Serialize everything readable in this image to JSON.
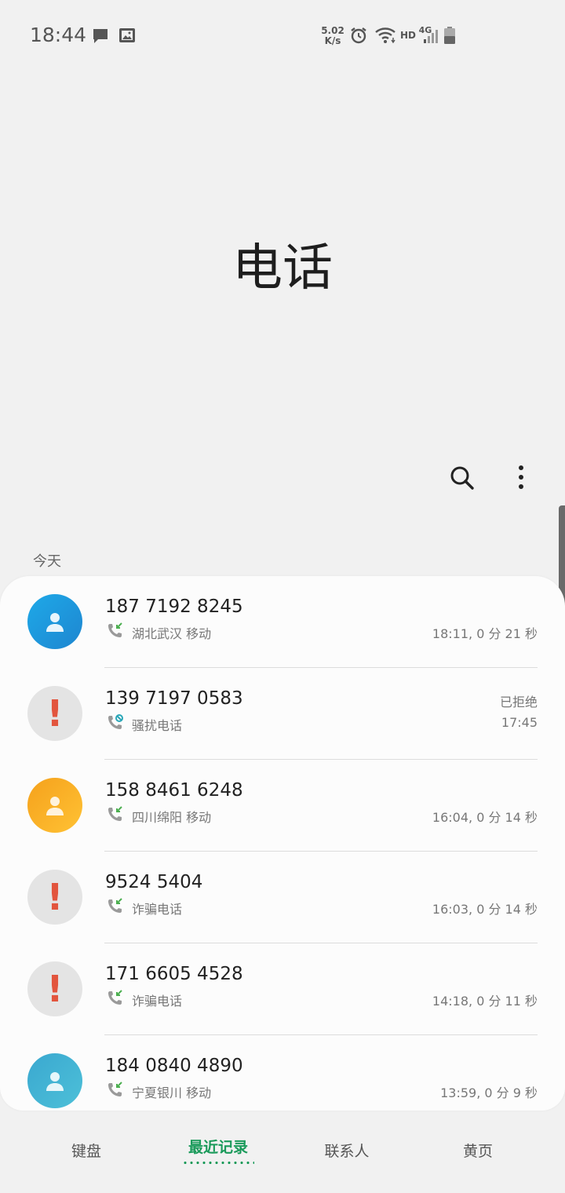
{
  "status_bar": {
    "time": "18:44",
    "net_speed_value": "5.02",
    "net_speed_unit": "K/s",
    "hd_label": "HD",
    "network_label": "4G",
    "icons": [
      "message-icon",
      "image-icon",
      "alarm-icon",
      "wifi-icon",
      "signal-icon",
      "battery-icon"
    ]
  },
  "header": {
    "title": "电话"
  },
  "actions": [
    "search-icon",
    "more-vert-icon"
  ],
  "section": {
    "label": "今天"
  },
  "calls": [
    {
      "number": "187 7192 8245",
      "sub": "湖北武汉 移动",
      "time": "18:11, 0 分 21 秒",
      "status": "",
      "avatar": "contact-blue",
      "call_type": "incoming"
    },
    {
      "number": "139 7197 0583",
      "sub": "骚扰电话",
      "time": "17:45",
      "status": "已拒绝",
      "avatar": "warning",
      "call_type": "rejected"
    },
    {
      "number": "158 8461 6248",
      "sub": "四川绵阳 移动",
      "time": "16:04, 0 分 14 秒",
      "status": "",
      "avatar": "contact-orange",
      "call_type": "incoming"
    },
    {
      "number": "9524 5404",
      "sub": "诈骗电话",
      "time": "16:03, 0 分 14 秒",
      "status": "",
      "avatar": "warning",
      "call_type": "incoming"
    },
    {
      "number": "171 6605 4528",
      "sub": "诈骗电话",
      "time": "14:18, 0 分 11 秒",
      "status": "",
      "avatar": "warning",
      "call_type": "incoming"
    },
    {
      "number": "184 0840 4890",
      "sub": "宁夏银川 移动",
      "time": "13:59, 0 分 9 秒",
      "status": "",
      "avatar": "contact-teal",
      "call_type": "incoming"
    }
  ],
  "tabs": [
    {
      "label": "键盘",
      "active": false
    },
    {
      "label": "最近记录",
      "active": true
    },
    {
      "label": "联系人",
      "active": false
    },
    {
      "label": "黄页",
      "active": false
    }
  ],
  "colors": {
    "accent": "#1a9a5a",
    "warning": "#e2553e",
    "incoming_arrow": "#4caf50",
    "rejected_icon": "#2aa7b8"
  }
}
